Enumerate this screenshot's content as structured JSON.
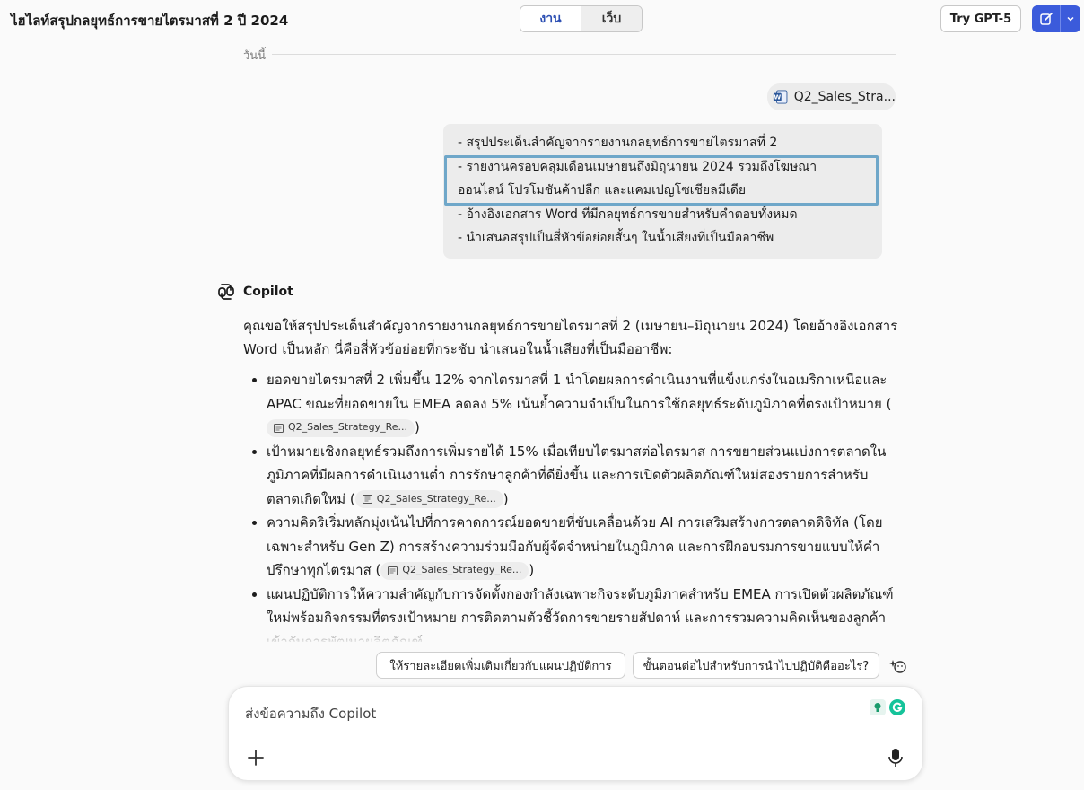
{
  "header": {
    "title": "ไฮไลท์สรุปกลยุทธ์การขายไตรมาสที่ 2 ปี 2024",
    "mode_tabs": [
      "งาน",
      "เว็บ"
    ],
    "active_mode": "งาน",
    "try_button": "Try GPT-5",
    "accent_color": "#3b5bdb"
  },
  "conversation": {
    "date_divider": "วันนี้",
    "attachment_name": "Q2_Sales_Stra...",
    "user_message_lines": [
      "- สรุปประเด็นสำคัญจากรายงานกลยุทธ์การขายไตรมาสที่ 2",
      "- รายงานครอบคลุมเดือนเมษายนถึงมิถุนายน 2024 รวมถึงโฆษณา",
      "ออนไลน์ โปรโมชันค้าปลีก และแคมเปญโซเชียลมีเดีย",
      "- อ้างอิงเอกสาร Word ที่มีกลยุทธ์การขายสำหรับคำตอบทั้งหมด",
      "- นำเสนอสรุปเป็นสี่หัวข้อย่อยสั้นๆ ในน้ำเสียงที่เป็นมืออาชีพ"
    ],
    "assistant_name": "Copilot",
    "assistant_intro": "คุณขอให้สรุปประเด็นสำคัญจากรายงานกลยุทธ์การขายไตรมาสที่ 2 (เมษายน–มิถุนายน 2024) โดยอ้างอิงเอกสาร Word เป็นหลัก นี่คือสี่หัวข้อย่อยที่กระชับ นำเสนอในน้ำเสียงที่เป็นมืออาชีพ:",
    "citation_label": "Q2_Sales_Strategy_Re...",
    "bullets": [
      "ยอดขายไตรมาสที่ 2 เพิ่มขึ้น 12% จากไตรมาสที่ 1 นำโดยผลการดำเนินงานที่แข็งแกร่งในอเมริกาเหนือและ APAC ขณะที่ยอดขายใน EMEA ลดลง 5% เน้นย้ำความจำเป็นในการใช้กลยุทธ์ระดับภูมิภาคที่ตรงเป้าหมาย",
      "เป้าหมายเชิงกลยุทธ์รวมถึงการเพิ่มรายได้ 15% เมื่อเทียบไตรมาสต่อไตรมาส การขยายส่วนแบ่งการตลาดในภูมิภาคที่มีผลการดำเนินงานต่ำ การรักษาลูกค้าที่ดียิ่งขึ้น และการเปิดตัวผลิตภัณฑ์ใหม่สองรายการสำหรับตลาดเกิดใหม่",
      "ความคิดริเริ่มหลักมุ่งเน้นไปที่การคาดการณ์ยอดขายที่ขับเคลื่อนด้วย AI การเสริมสร้างการตลาดดิจิทัล (โดยเฉพาะสำหรับ Gen Z) การสร้างความร่วมมือกับผู้จัดจำหน่ายในภูมิภาค และการฝึกอบรมการขายแบบให้คำปรึกษาทุกไตรมาส",
      "แผนปฏิบัติการให้ความสำคัญกับการจัดตั้งกองกำลังเฉพาะกิจระดับภูมิภาคสำหรับ EMEA การเปิดตัวผลิตภัณฑ์ใหม่พร้อมกิจกรรมที่ตรงเป้าหมาย การติดตามตัวชี้วัดการขายรายสัปดาห์ และการรวมความคิดเห็นของลูกค้าเข้ากับการพัฒนาผลิตภัณฑ์"
    ]
  },
  "suggestions": [
    "ให้รายละเอียดเพิ่มเติมเกี่ยวกับแผนปฏิบัติการ",
    "ขั้นตอนต่อไปสำหรับการนำไปปฏิบัติคืออะไร?"
  ],
  "composer": {
    "placeholder": "ส่งข้อความถึง Copilot"
  }
}
